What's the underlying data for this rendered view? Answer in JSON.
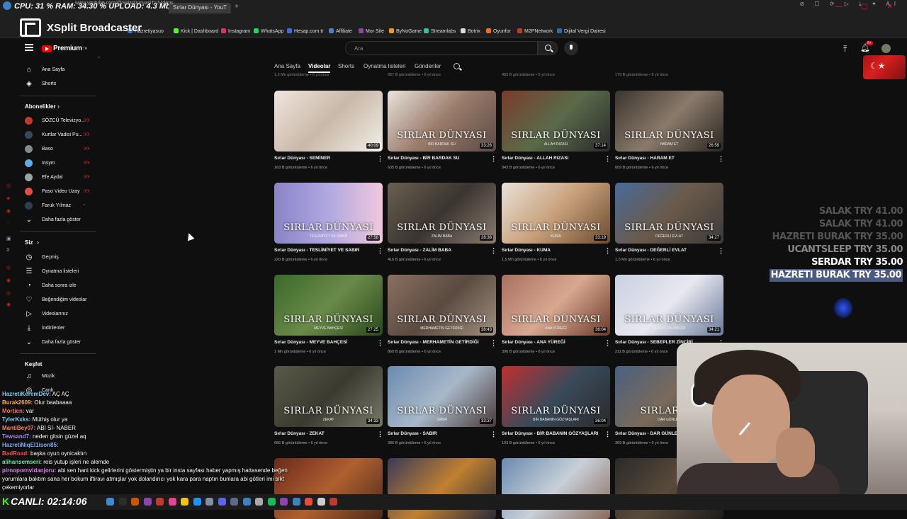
{
  "stats": {
    "text": "CPU: 31 % RAM:  34.30 % UPLOAD: 4.3 Mbps"
  },
  "browser": {
    "active_tab": "Sırlar Dünyası - YouT",
    "url": "www.youtube.com/@SirlarDunyasiTV/videos"
  },
  "xsplit": {
    "name": "XSplit Broadcaster"
  },
  "bookmarks": [
    {
      "label": "Hazretiyasuo",
      "color": "#3b6fd1"
    },
    {
      "label": "Kick | Dashboard",
      "color": "#53fc18"
    },
    {
      "label": "Instagram",
      "color": "#e1306c"
    },
    {
      "label": "WhatsApp",
      "color": "#25d366"
    },
    {
      "label": "Hesap.com.tr",
      "color": "#3a6ee8"
    },
    {
      "label": "Affiliate",
      "color": "#4a7fd6"
    },
    {
      "label": "Mor Site",
      "color": "#8e44ad"
    },
    {
      "label": "ByNoGame",
      "color": "#f39c12"
    },
    {
      "label": "Streamlabs",
      "color": "#31c3a2"
    },
    {
      "label": "Botrix",
      "color": "#dddddd"
    },
    {
      "label": "Oyunfor",
      "color": "#f07020"
    },
    {
      "label": "M2PNetwork",
      "color": "#c0392b"
    },
    {
      "label": "Dijital Vergi Dairesi",
      "color": "#2b6cb0"
    }
  ],
  "youtube": {
    "logo_text": "Premium",
    "logo_sup": "TR",
    "search_placeholder": "Ara",
    "notification_count": "9+"
  },
  "channel_tabs": [
    "Ana Sayfa",
    "Videolar",
    "Shorts",
    "Oynatma listeleri",
    "Gönderiler"
  ],
  "sidebar": {
    "top": [
      {
        "label": "Ana Sayfa",
        "icon": "home-icon",
        "glyph": "⌂"
      },
      {
        "label": "Shorts",
        "icon": "shorts-icon",
        "glyph": "◈"
      }
    ],
    "subscriptions_heading": "Abonelikler",
    "subscriptions": [
      {
        "label": "SÖZCÜ Televizyo...",
        "color": "#c0392b"
      },
      {
        "label": "Kurtlar Vadisi Pu...",
        "color": "#34495e"
      },
      {
        "label": "Baso",
        "color": "#7f8c8d"
      },
      {
        "label": "Insym",
        "color": "#5dade2"
      },
      {
        "label": "Efe Aydal",
        "color": "#95a5a6"
      },
      {
        "label": "Paso Video Uzay",
        "color": "#e74c3c"
      },
      {
        "label": "Faruk Yılmaz",
        "color": "#2c3e50"
      }
    ],
    "show_more": "Daha fazla göster",
    "you_heading": "Siz",
    "you": [
      {
        "label": "Geçmiş",
        "icon": "history-icon",
        "glyph": "◷"
      },
      {
        "label": "Oynatma listeleri",
        "icon": "playlist-icon",
        "glyph": "☰"
      },
      {
        "label": "Daha sonra izle",
        "icon": "watch-later-icon",
        "glyph": "◔"
      },
      {
        "label": "Beğendiğim videolar",
        "icon": "like-icon",
        "glyph": "♡"
      },
      {
        "label": "Videolarınız",
        "icon": "your-videos-icon",
        "glyph": "▷"
      },
      {
        "label": "İndirilenler",
        "icon": "download-icon",
        "glyph": "⤓"
      },
      {
        "label": "Daha fazla göster",
        "icon": "chevron-down-icon",
        "glyph": "⌄"
      }
    ],
    "explore_heading": "Keşfet",
    "explore": [
      {
        "label": "Müzik",
        "icon": "music-icon",
        "glyph": "♫"
      },
      {
        "label": "Canlı",
        "icon": "live-icon",
        "glyph": "◎"
      }
    ]
  },
  "prev_row_meta": [
    "1,2 Mn görüntüleme • 6 yıl önce",
    "957 B görüntüleme • 6 yıl önce",
    "483 B görüntüleme • 6 yıl önce",
    "179 B görüntüleme • 6 yıl önce"
  ],
  "videos": [
    {
      "title": "Sırlar Dünyası - SEMİNER",
      "meta": "163 B görüntüleme • 6 yıl önce",
      "duration": "40:09",
      "watermark": "",
      "sub": "",
      "bg": "linear-gradient(135deg,#efe6dd 0%,#c9b8a8 50%,#f2efe9 100%)"
    },
    {
      "title": "Sırlar Dünyası - BİR BARDAK SU",
      "meta": "635 B görüntüleme • 6 yıl önce",
      "duration": "33:26",
      "watermark": "SIRLAR DÜNYASI",
      "sub": "BİR BARDAK SU",
      "bg": "linear-gradient(135deg,#e9e3dc 0%,#9a7b6a 50%,#5b4a44 100%)"
    },
    {
      "title": "Sırlar Dünyası - ALLAH RIZASI",
      "meta": "943 B görüntüleme • 6 yıl önce",
      "duration": "37:14",
      "watermark": "SIRLAR DÜNYASI",
      "sub": "ALLAH RIZASI",
      "bg": "linear-gradient(135deg,#7b3b2c 0%,#5a6b4a 50%,#2a2a2a 100%)"
    },
    {
      "title": "Sırlar Dünyası - HARAM ET",
      "meta": "609 B görüntüleme • 6 yıl önce",
      "duration": "26:59",
      "watermark": "SIRLAR DÜNYASI",
      "sub": "HARAM ET",
      "bg": "linear-gradient(135deg,#3a3530 0%,#8a7a6a 50%,#2a2520 100%)"
    },
    {
      "title": "Sırlar Dünyası - TESLİMİYET VE SABIR",
      "meta": "220 B görüntüleme • 6 yıl önce",
      "duration": "27:58",
      "watermark": "SIRLAR DÜNYASI",
      "sub": "TESLİMİYET VE SABIR",
      "bg": "linear-gradient(90deg,#8a84c8 0%,#b0a8e0 50%,#f0c8dc 100%)"
    },
    {
      "title": "Sırlar Dünyası - ZALİM BABA",
      "meta": "416 B görüntüleme • 6 yıl önce",
      "duration": "28:38",
      "watermark": "SIRLAR DÜNYASI",
      "sub": "ZALİM BABA",
      "bg": "linear-gradient(135deg,#6a6050 0%,#3a3530 50%,#8a7a70 100%)"
    },
    {
      "title": "Sırlar Dünyası - KUMA",
      "meta": "1,5 Mn görüntüleme • 6 yıl önce",
      "duration": "33:19",
      "watermark": "SIRLAR DÜNYASI",
      "sub": "KUMA",
      "bg": "linear-gradient(135deg,#e8e2d8 0%,#c8a07a 50%,#6a4a30 100%)"
    },
    {
      "title": "Sırlar Dünyası - DEĞERLİ EVLAT",
      "meta": "1,5 Mn görüntüleme • 6 yıl önce",
      "duration": "34:27",
      "watermark": "SIRLAR DÜNYASI",
      "sub": "DEĞERLİ EVLAT",
      "bg": "linear-gradient(135deg,#4a6a9a 0%,#6a5a4a 50%,#3a3a3a 100%)"
    },
    {
      "title": "Sırlar Dünyası - MEYVE BAHÇESİ",
      "meta": "1 Mn görüntüleme • 6 yıl önce",
      "duration": "27:25",
      "watermark": "SIRLAR DÜNYASI",
      "sub": "MEYVE BAHÇESİ",
      "bg": "linear-gradient(135deg,#3a6a2a 0%,#6a8a4a 50%,#2a4a1a 100%)"
    },
    {
      "title": "Sırlar Dünyası - MERHAMETİN GETİRDİĞİ",
      "meta": "860 B görüntüleme • 6 yıl önce",
      "duration": "38:43",
      "watermark": "SIRLAR DÜNYASI",
      "sub": "MERHAMETİN GETİRDİĞİ",
      "bg": "linear-gradient(135deg,#8a7060 0%,#5a4a40 50%,#a09080 100%)"
    },
    {
      "title": "Sırlar Dünyası - ANA YÜREĞİ",
      "meta": "396 B görüntüleme • 6 yıl önce",
      "duration": "36:04",
      "watermark": "SIRLAR DÜNYASI",
      "sub": "ANA YÜREĞİ",
      "bg": "linear-gradient(135deg,#a87060 0%,#d8a890 50%,#6a3a2a 100%)"
    },
    {
      "title": "Sırlar Dünyası - SEBEPLER ZİNCİRİ",
      "meta": "211 B görüntüleme • 6 yıl önce",
      "duration": "34:21",
      "watermark": "SIRLAR DÜNYASI",
      "sub": "SEBEPLER ZİNCİRİ",
      "bg": "linear-gradient(135deg,#c8d0e0 0%,#e8e8f0 50%,#6a7a9a 100%)"
    },
    {
      "title": "Sırlar Dünyası - ZEKAT",
      "meta": "686 B görüntüleme • 6 yıl önce",
      "duration": "34:33",
      "watermark": "SIRLAR DÜNYASI",
      "sub": "ZEKAT",
      "bg": "linear-gradient(135deg,#5a5a4a 0%,#3a3a30 50%,#7a7a6a 100%)"
    },
    {
      "title": "Sırlar Dünyası - SABIR",
      "meta": "386 B görüntüleme • 6 yıl önce",
      "duration": "33:37",
      "watermark": "SIRLAR DÜNYASI",
      "sub": "SABIR",
      "bg": "linear-gradient(135deg,#6a8ab0 0%,#a8b8c8 50%,#4a3a3a 100%)"
    },
    {
      "title": "Sırlar Dünyası - BİR BABANIN GÖZYAŞLARI",
      "meta": "103 B görüntüleme • 6 yıl önce",
      "duration": "36:04",
      "watermark": "SIRLAR DÜNYASI",
      "sub": "BİR BABANIN GÖZYAŞLARI",
      "bg": "linear-gradient(135deg,#c03030 0%,#3a4a5a 50%,#2a2a2a 100%)"
    },
    {
      "title": "Sırlar Dünyası - DAR GÜNLER",
      "meta": "369 B görüntüleme • 6 yıl önce",
      "duration": "",
      "watermark": "SIRLAR DÜ",
      "sub": "DAR GÜNLER",
      "bg": "linear-gradient(135deg,#4a6080 0%,#7a6a5a 50%,#3a3a3a 100%)"
    },
    {
      "title": "",
      "meta": "",
      "duration": "",
      "watermark": "",
      "sub": "",
      "bg": "linear-gradient(135deg,#6a2a1a 0%,#b06030 50%,#4a2a1a 100%)"
    },
    {
      "title": "",
      "meta": "",
      "duration": "",
      "watermark": "",
      "sub": "",
      "bg": "linear-gradient(135deg,#3a3a5a 0%,#c08030 50%,#2a2a3a 100%)"
    },
    {
      "title": "",
      "meta": "",
      "duration": "",
      "watermark": "",
      "sub": "",
      "bg": "linear-gradient(135deg,#6a8ab0 0%,#c8d0d8 50%,#8a6a5a 100%)"
    },
    {
      "title": "",
      "meta": "",
      "duration": "",
      "watermark": "",
      "sub": "",
      "bg": "linear-gradient(135deg,#2a2a2a 0%,#5a4a3a 50%,#1a1a1a 100%)"
    }
  ],
  "donations": [
    {
      "name": "SALAK",
      "amount": "TRY 41.00",
      "style": "faded"
    },
    {
      "name": "SALAK",
      "amount": "TRY 41.00",
      "style": "faded"
    },
    {
      "name": "HAZRETI BURAK",
      "amount": "TRY 35.00",
      "style": "faded"
    },
    {
      "name": "UCANTSLEEP",
      "amount": "TRY 35.00",
      "style": "mid"
    },
    {
      "name": "SERDAR",
      "amount": "TRY 35.00",
      "style": "bright"
    },
    {
      "name": "HAZRETI BURAK",
      "amount": "TRY 35.00",
      "style": "hl"
    }
  ],
  "chat": [
    {
      "user": "HazretiKeremDev:",
      "msg": "AÇ AÇ",
      "color": "#7fd4ff"
    },
    {
      "user": "Burak2609:",
      "msg": "Olur baabaaaa",
      "color": "#ffb347"
    },
    {
      "user": "Mortien:",
      "msg": "var",
      "color": "#ff6b6b"
    },
    {
      "user": "TylerKxks:",
      "msg": "Müthiş olur ya",
      "color": "#7fd4ff"
    },
    {
      "user": "MantiBey07:",
      "msg": "ABİ Sİ- NABER",
      "color": "#ff8a65"
    },
    {
      "user": "Tewsand7:",
      "msg": "neden gitsin güzel aq",
      "color": "#b388ff"
    },
    {
      "user": "HazretiNiqEl1ison85:",
      "msg": "",
      "color": "#82b1ff"
    },
    {
      "user": "BadRoad:",
      "msg": "başka oyun oynicaktın",
      "color": "#ff5252"
    },
    {
      "user": "alihansemseri:",
      "msg": "reis yutup işleri ne alemde",
      "color": "#69f0ae"
    },
    {
      "user": "pirnopornvidanjoru:",
      "msg": "abi sen hani kick gelirlerini göstermiştin ya bir insta sayfası haber yapmış hattasende beğen",
      "color": "#ea80fc"
    },
    {
      "user": "",
      "msg": "yorumlara baktım sana her bokum iftiravı atmışlar yok dolandırıcı yok kara para naptın bunlara abi götleri imi sıkt",
      "color": "#ffffff"
    },
    {
      "user": "",
      "msg": "çekemiyorlar",
      "color": "#ffffff"
    }
  ],
  "live": {
    "label": "CANLI:",
    "time": "02:14:06"
  }
}
